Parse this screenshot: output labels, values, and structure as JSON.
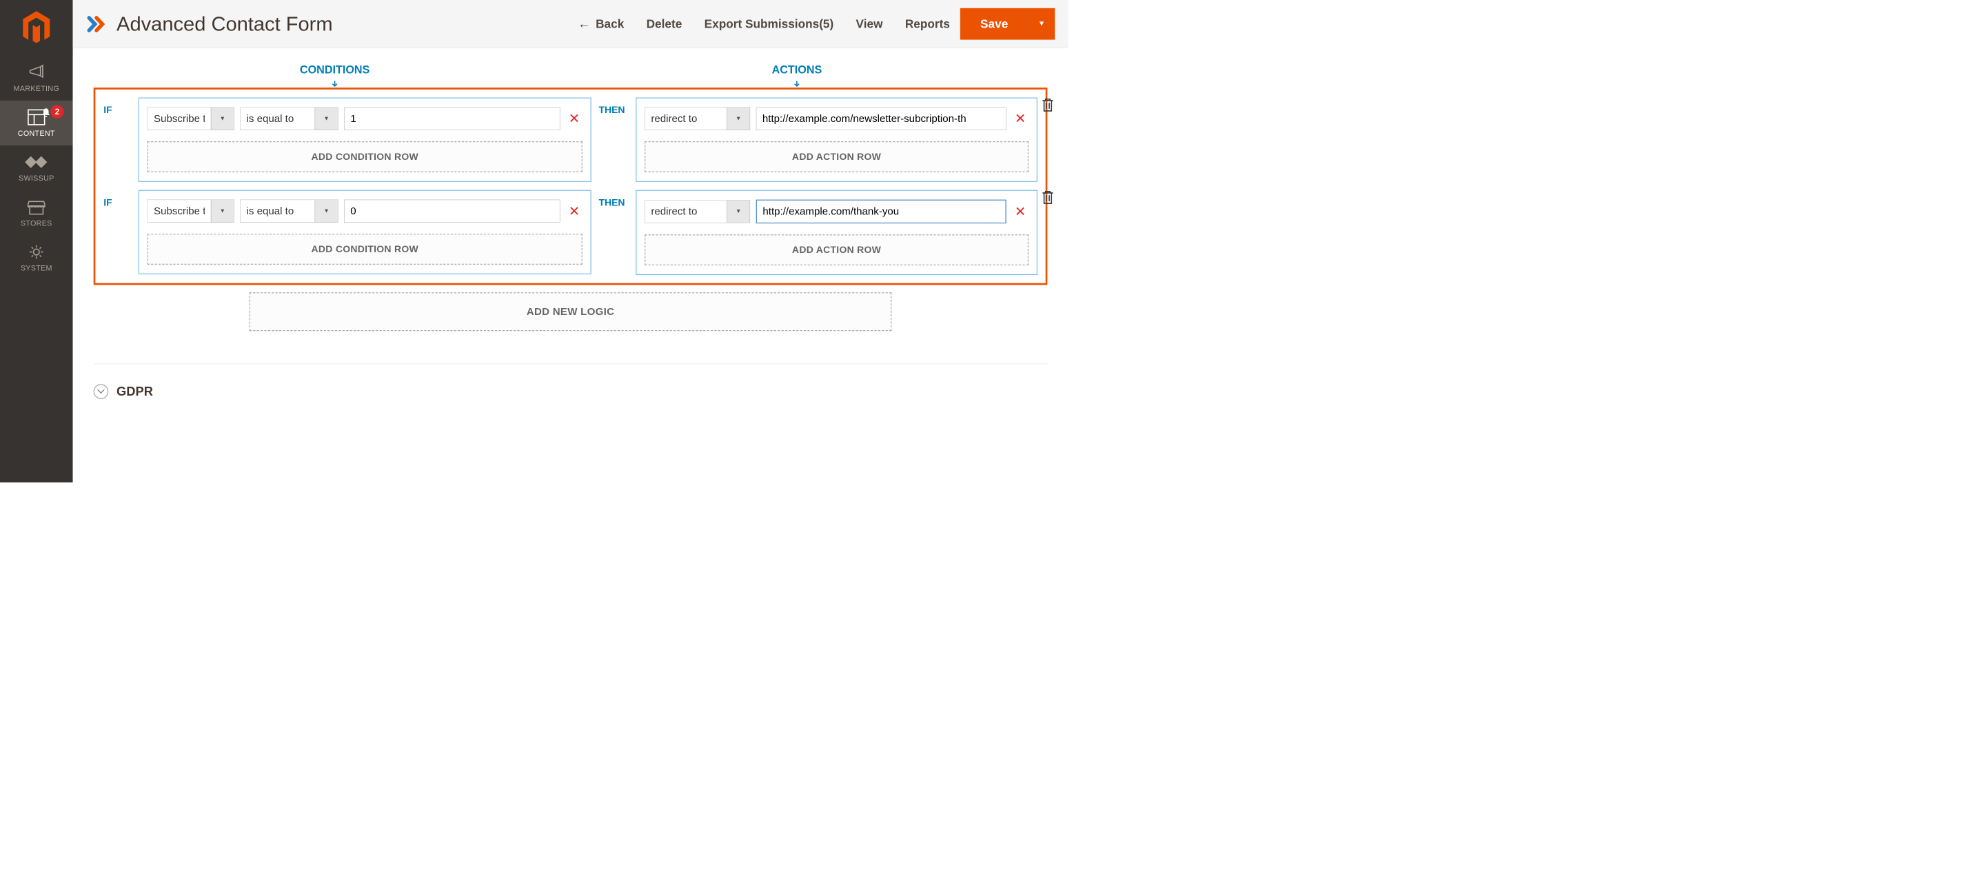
{
  "header": {
    "title": "Advanced Contact Form",
    "back": "Back",
    "delete": "Delete",
    "export": "Export Submissions(5)",
    "view": "View",
    "reports": "Reports",
    "save": "Save"
  },
  "sidebar": {
    "marketing": "MARKETING",
    "content": "CONTENT",
    "swissup": "SWISSUP",
    "stores": "STORES",
    "system": "SYSTEM",
    "badge": "2"
  },
  "labels": {
    "conditions": "CONDITIONS",
    "actions": "ACTIONS",
    "if": "IF",
    "then": "THEN",
    "add_condition": "ADD CONDITION ROW",
    "add_action": "ADD ACTION ROW",
    "add_logic": "ADD NEW LOGIC",
    "gdpr": "GDPR"
  },
  "rows": [
    {
      "cond": {
        "field": "Subscribe to",
        "op": "is equal to",
        "val": "1"
      },
      "act": {
        "type": "redirect to",
        "url": "http://example.com/newsletter-subcription-th"
      }
    },
    {
      "cond": {
        "field": "Subscribe to",
        "op": "is equal to",
        "val": "0"
      },
      "act": {
        "type": "redirect to",
        "url": "http://example.com/thank-you"
      }
    }
  ]
}
